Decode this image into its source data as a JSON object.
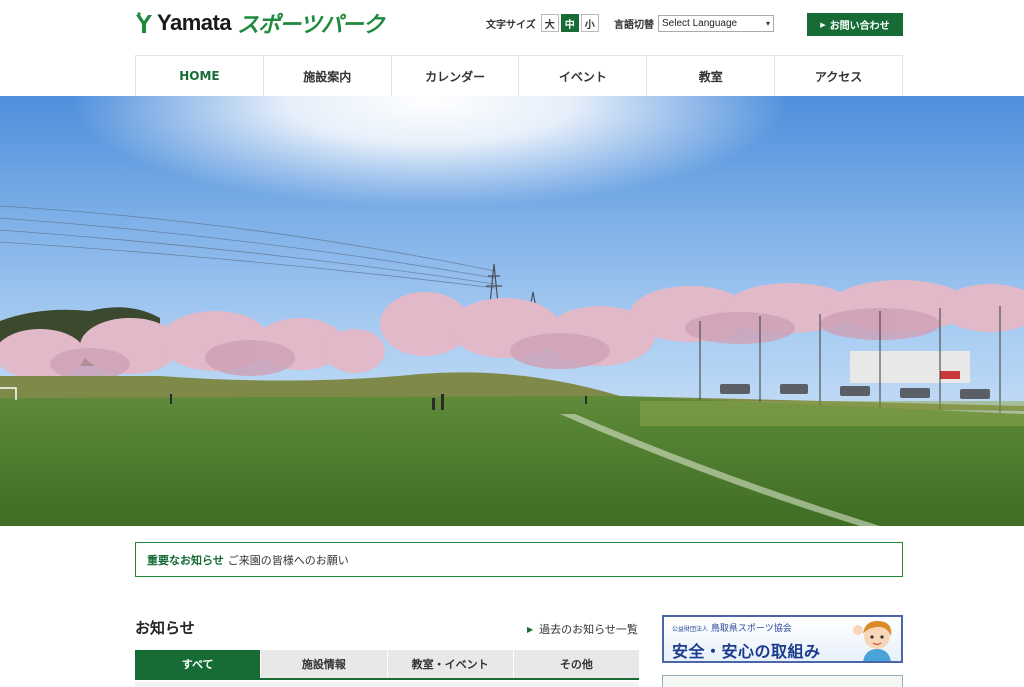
{
  "header": {
    "logo_prefix": "Yamata",
    "logo_name": "スポーツパーク",
    "font_size_label": "文字サイズ",
    "font_sizes": [
      "大",
      "中",
      "小"
    ],
    "font_size_active": "中",
    "language_label": "言語切替",
    "language_select": "Select Language",
    "contact_label": "お問い合わせ"
  },
  "nav": {
    "items": [
      "HOME",
      "施設案内",
      "カレンダー",
      "イベント",
      "教室",
      "アクセス"
    ],
    "active": "HOME"
  },
  "notice": {
    "label": "重要なお知らせ",
    "text": "ご来園の皆様へのお願い"
  },
  "news": {
    "title": "お知らせ",
    "past_link": "過去のお知らせ一覧",
    "tabs": [
      "すべて",
      "施設情報",
      "教室・イベント",
      "その他"
    ],
    "active_tab": "すべて"
  },
  "banner": {
    "org_prefix": "公益財団法人",
    "org": "鳥取県スポーツ協会",
    "main": "安全・安心の取組み"
  },
  "colors": {
    "brand_green": "#176c36",
    "logo_green": "#1f8a3c",
    "banner_blue": "#1a3a8a"
  }
}
